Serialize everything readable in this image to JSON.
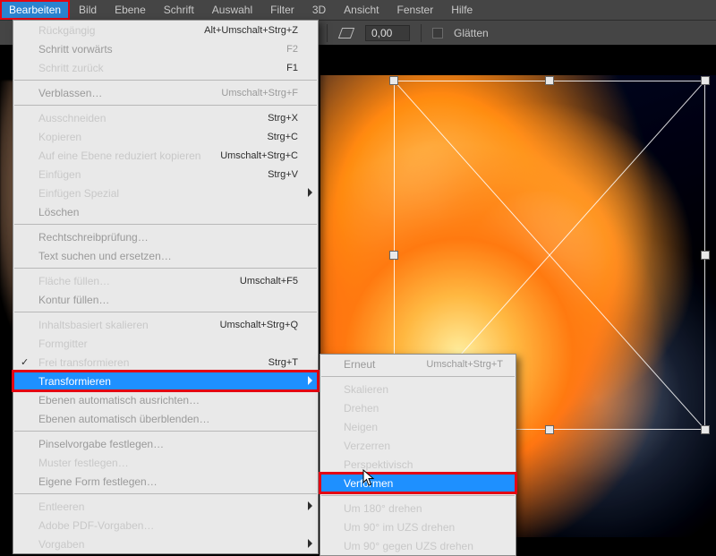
{
  "menubar": [
    "Bearbeiten",
    "Bild",
    "Ebene",
    "Schrift",
    "Auswahl",
    "Filter",
    "3D",
    "Ansicht",
    "Fenster",
    "Hilfe"
  ],
  "active_menu_index": 0,
  "optionsbar": {
    "angle_value": "0,00",
    "smooth_label": "Glätten"
  },
  "edit_menu": [
    {
      "type": "item",
      "label": "Rückgängig",
      "shortcut": "Alt+Umschalt+Strg+Z"
    },
    {
      "type": "item",
      "label": "Schritt vorwärts",
      "shortcut": "F2",
      "disabled": true
    },
    {
      "type": "item",
      "label": "Schritt zurück",
      "shortcut": "F1"
    },
    {
      "type": "sep"
    },
    {
      "type": "item",
      "label": "Verblassen…",
      "shortcut": "Umschalt+Strg+F",
      "disabled": true
    },
    {
      "type": "sep"
    },
    {
      "type": "item",
      "label": "Ausschneiden",
      "shortcut": "Strg+X"
    },
    {
      "type": "item",
      "label": "Kopieren",
      "shortcut": "Strg+C"
    },
    {
      "type": "item",
      "label": "Auf eine Ebene reduziert kopieren",
      "shortcut": "Umschalt+Strg+C"
    },
    {
      "type": "item",
      "label": "Einfügen",
      "shortcut": "Strg+V"
    },
    {
      "type": "item",
      "label": "Einfügen Spezial",
      "submenu": true
    },
    {
      "type": "item",
      "label": "Löschen",
      "disabled": true
    },
    {
      "type": "sep"
    },
    {
      "type": "item",
      "label": "Rechtschreibprüfung…",
      "disabled": true
    },
    {
      "type": "item",
      "label": "Text suchen und ersetzen…",
      "disabled": true
    },
    {
      "type": "sep"
    },
    {
      "type": "item",
      "label": "Fläche füllen…",
      "shortcut": "Umschalt+F5"
    },
    {
      "type": "item",
      "label": "Kontur füllen…",
      "disabled": true
    },
    {
      "type": "sep"
    },
    {
      "type": "item",
      "label": "Inhaltsbasiert skalieren",
      "shortcut": "Umschalt+Strg+Q"
    },
    {
      "type": "item",
      "label": "Formgitter"
    },
    {
      "type": "item",
      "label": "Frei transformieren",
      "shortcut": "Strg+T",
      "checked": true
    },
    {
      "type": "item",
      "label": "Transformieren",
      "submenu": true,
      "highlight": true,
      "redbox": true
    },
    {
      "type": "item",
      "label": "Ebenen automatisch ausrichten…",
      "disabled": true
    },
    {
      "type": "item",
      "label": "Ebenen automatisch überblenden…",
      "disabled": true
    },
    {
      "type": "sep"
    },
    {
      "type": "item",
      "label": "Pinselvorgabe festlegen…",
      "disabled": true
    },
    {
      "type": "item",
      "label": "Muster festlegen…"
    },
    {
      "type": "item",
      "label": "Eigene Form festlegen…",
      "disabled": true
    },
    {
      "type": "sep"
    },
    {
      "type": "item",
      "label": "Entleeren",
      "submenu": true
    },
    {
      "type": "item",
      "label": "Adobe PDF-Vorgaben…"
    },
    {
      "type": "item",
      "label": "Vorgaben",
      "submenu": true
    }
  ],
  "transform_submenu": [
    {
      "type": "item",
      "label": "Erneut",
      "shortcut": "Umschalt+Strg+T",
      "disabled": true
    },
    {
      "type": "sep"
    },
    {
      "type": "item",
      "label": "Skalieren"
    },
    {
      "type": "item",
      "label": "Drehen"
    },
    {
      "type": "item",
      "label": "Neigen"
    },
    {
      "type": "item",
      "label": "Verzerren"
    },
    {
      "type": "item",
      "label": "Perspektivisch"
    },
    {
      "type": "item",
      "label": "Verformen",
      "highlight": true,
      "redbox": true
    },
    {
      "type": "sep"
    },
    {
      "type": "item",
      "label": "Um 180° drehen"
    },
    {
      "type": "item",
      "label": "Um 90° im UZS drehen"
    },
    {
      "type": "item",
      "label": "Um 90° gegen UZS drehen"
    }
  ]
}
